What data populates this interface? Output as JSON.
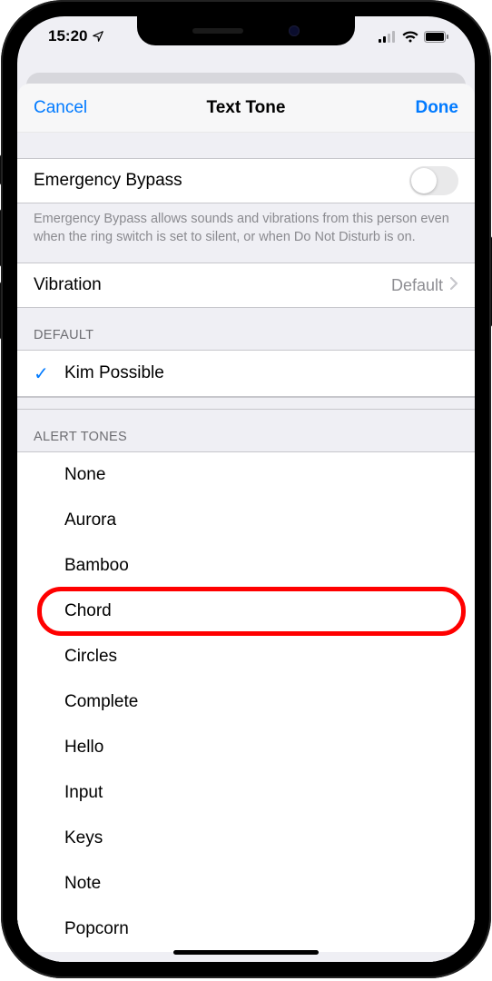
{
  "statusbar": {
    "time": "15:20"
  },
  "navbar": {
    "cancel": "Cancel",
    "title": "Text Tone",
    "done": "Done"
  },
  "emergency": {
    "label": "Emergency Bypass",
    "enabled": false,
    "footer": "Emergency Bypass allows sounds and vibrations from this person even when the ring switch is set to silent, or when Do Not Disturb is on."
  },
  "vibration": {
    "label": "Vibration",
    "value": "Default"
  },
  "sections": {
    "default": {
      "header": "DEFAULT",
      "items": [
        {
          "label": "Kim Possible",
          "checked": true
        }
      ]
    },
    "alert": {
      "header": "ALERT TONES",
      "items": [
        {
          "label": "None"
        },
        {
          "label": "Aurora"
        },
        {
          "label": "Bamboo"
        },
        {
          "label": "Chord",
          "highlighted": true
        },
        {
          "label": "Circles"
        },
        {
          "label": "Complete"
        },
        {
          "label": "Hello"
        },
        {
          "label": "Input"
        },
        {
          "label": "Keys"
        },
        {
          "label": "Note"
        },
        {
          "label": "Popcorn"
        }
      ]
    }
  }
}
